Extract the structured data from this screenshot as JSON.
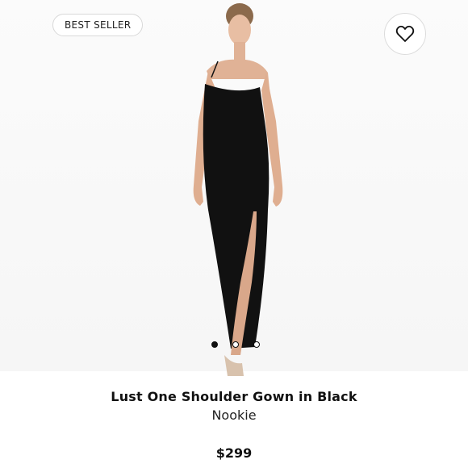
{
  "badge": {
    "label": "BEST SELLER"
  },
  "product": {
    "title": "Lust One Shoulder Gown in Black",
    "brand": "Nookie",
    "price": "$299"
  },
  "gallery": {
    "image_count": 3,
    "active_index": 0
  },
  "icons": {
    "favorite": "heart-outline-icon"
  },
  "colors": {
    "dress": "#111111",
    "skin": "#e0b296",
    "text": "#111111"
  }
}
